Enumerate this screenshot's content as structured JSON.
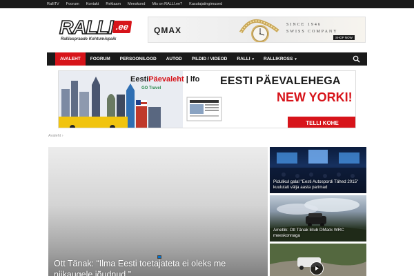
{
  "topbar": {
    "links": [
      "RalliTV",
      "Foorum",
      "Kontakt",
      "Reklaam",
      "Meeskond",
      "Mis on RALLI.ee?",
      "Kasutajatingimused"
    ]
  },
  "logo": {
    "word": "RALLI",
    "tld": ".ee",
    "tagline": "Ralliaspraade Kohtumispaik"
  },
  "ad_top": {
    "brand": "QMAX",
    "since": "SINCE 1946",
    "swiss": "SWISS COMPANY",
    "shop": "SHOP NOW"
  },
  "nav": {
    "items": [
      {
        "label": "AVALEHT",
        "active": true
      },
      {
        "label": "FOORUM"
      },
      {
        "label": "PERSOONILOOD"
      },
      {
        "label": "AUTOD"
      },
      {
        "label": "PILDID / VIDEOD"
      },
      {
        "label": "RALLI",
        "caret": "▾"
      },
      {
        "label": "RALLIKROSS",
        "caret": "▾"
      }
    ]
  },
  "ad_banner": {
    "brand_black": "Eesti",
    "brand_red": "Päevaleht",
    "brand_suffix": "| lfo",
    "travel": "GO Travel",
    "headline_1": "EESTI PÄEVALEHEGA",
    "headline_2": "NEW YORKI!",
    "cta": "TELLI KOHE"
  },
  "breadcrumb": {
    "label": "Avaleht",
    "sep": "›"
  },
  "hero": {
    "title": "Ott Tänak: “Ilma Eesti toetajateta ei oleks me niikaugele jõudnud.”"
  },
  "cards": [
    {
      "title": "Pidulikul galal \"Eesti Autospordi Tähed 2015\" kuulutati välja aasta parimad"
    },
    {
      "title": "Ametlik: Ott Tänak liitub DMack WRC meeskonnaga"
    },
    {
      "title": ""
    }
  ],
  "colors": {
    "accent": "#d7141a",
    "nav_bg": "#1a1a1a"
  }
}
